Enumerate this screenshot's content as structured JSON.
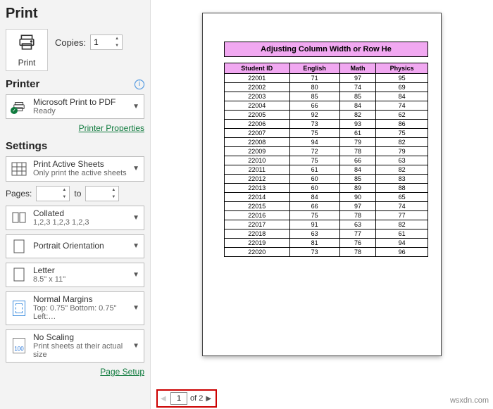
{
  "title": "Print",
  "print_button": "Print",
  "copies": {
    "label": "Copies:",
    "value": "1"
  },
  "printer": {
    "heading": "Printer",
    "name": "Microsoft Print to PDF",
    "status": "Ready",
    "properties_link": "Printer Properties"
  },
  "settings": {
    "heading": "Settings",
    "print_active": {
      "line1": "Print Active Sheets",
      "line2": "Only print the active sheets"
    },
    "pages_label": "Pages:",
    "to_label": "to",
    "collated": {
      "line1": "Collated",
      "line2": "1,2,3   1,2,3   1,2,3"
    },
    "orientation": {
      "line1": "Portrait Orientation"
    },
    "paper": {
      "line1": "Letter",
      "line2": "8.5\" x 11\""
    },
    "margins": {
      "line1": "Normal Margins",
      "line2": "Top: 0.75\" Bottom: 0.75\" Left:…"
    },
    "scaling": {
      "line1": "No Scaling",
      "line2": "Print sheets at their actual size",
      "icon_value": "100"
    },
    "page_setup_link": "Page Setup"
  },
  "preview": {
    "sheet_title": "Adjusting Column Width or Row He",
    "headers": [
      "Student ID",
      "English",
      "Math",
      "Physics"
    ],
    "rows": [
      [
        "22001",
        "71",
        "97",
        "95"
      ],
      [
        "22002",
        "80",
        "74",
        "69"
      ],
      [
        "22003",
        "85",
        "85",
        "84"
      ],
      [
        "22004",
        "66",
        "84",
        "74"
      ],
      [
        "22005",
        "92",
        "82",
        "62"
      ],
      [
        "22006",
        "73",
        "93",
        "86"
      ],
      [
        "22007",
        "75",
        "61",
        "75"
      ],
      [
        "22008",
        "94",
        "79",
        "82"
      ],
      [
        "22009",
        "72",
        "78",
        "79"
      ],
      [
        "22010",
        "75",
        "66",
        "63"
      ],
      [
        "22011",
        "61",
        "84",
        "82"
      ],
      [
        "22012",
        "60",
        "85",
        "83"
      ],
      [
        "22013",
        "60",
        "89",
        "88"
      ],
      [
        "22014",
        "84",
        "90",
        "65"
      ],
      [
        "22015",
        "66",
        "97",
        "74"
      ],
      [
        "22016",
        "75",
        "78",
        "77"
      ],
      [
        "22017",
        "91",
        "63",
        "82"
      ],
      [
        "22018",
        "63",
        "77",
        "61"
      ],
      [
        "22019",
        "81",
        "76",
        "94"
      ],
      [
        "22020",
        "73",
        "78",
        "96"
      ]
    ]
  },
  "pager": {
    "current": "1",
    "total_text": "of 2"
  },
  "watermark": "wsxdn.com"
}
